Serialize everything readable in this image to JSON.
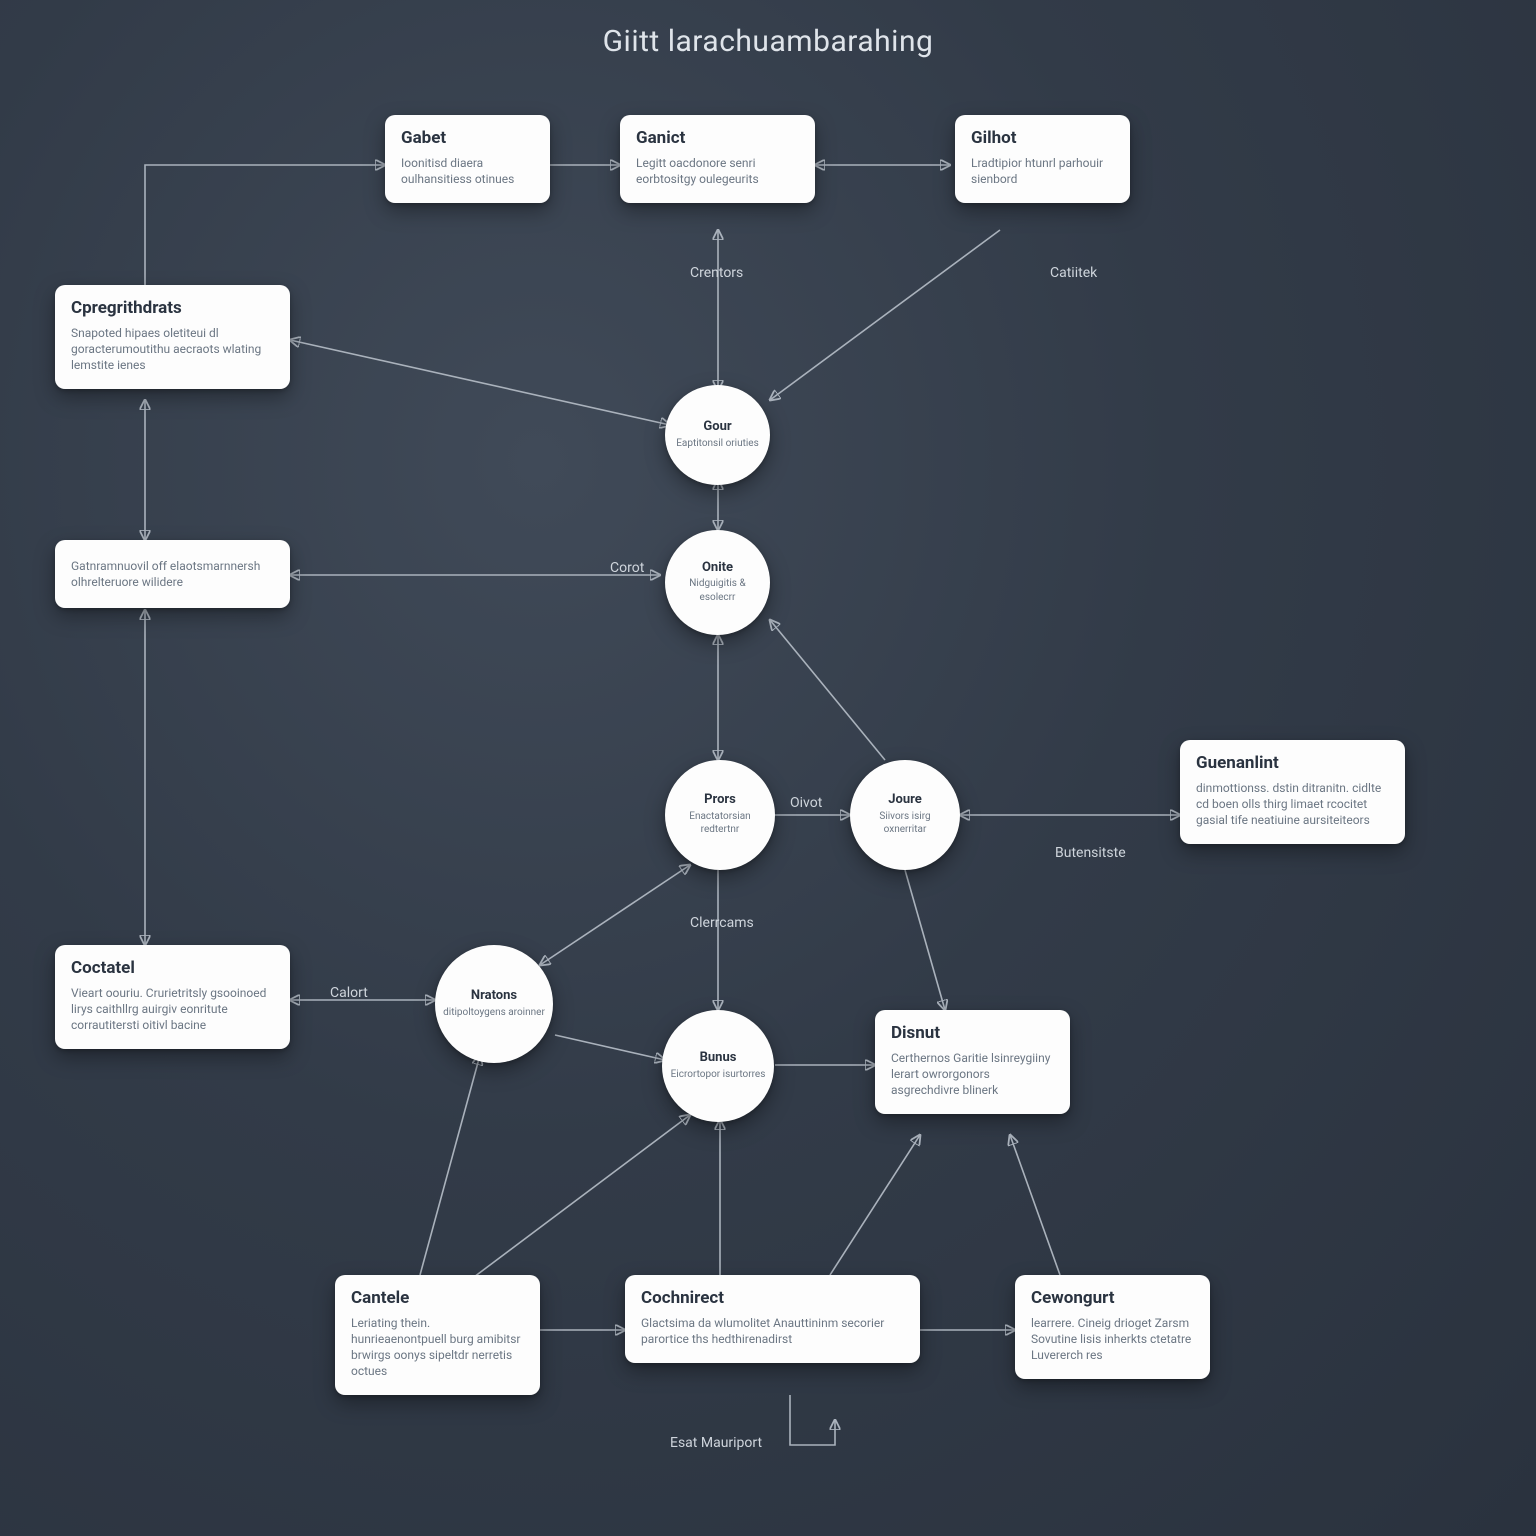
{
  "title": "Giitt larachuambarahing",
  "nodes": {
    "gabet": {
      "title": "Gabet",
      "body": "Ioonitisd diaera oulhansitiess otinues"
    },
    "ganict": {
      "title": "Ganict",
      "body": "Legitt oacdonore senri eorbtositgy oulegeurits"
    },
    "gilhot": {
      "title": "Gilhot",
      "body": "Lradtipior htunrl parhouir sienbord"
    },
    "cpregithdrats": {
      "title": "Cpregrithdrats",
      "body": "Snapoted hipaes oletiteui dl goracterumoutithu aecraots wlating lemstite ienes"
    },
    "gcompound": {
      "title": "",
      "body": "Gatnramnuovil off elaotsmarnnersh olhrelteruore wilidere"
    },
    "coctatel": {
      "title": "Coctatel",
      "body": "Vieart oouriu. Crurietritsly gsooinoed lirys caithllrg auirgiv eonritute corrautitersti oitivl bacine"
    },
    "guenanlint": {
      "title": "Guenanlint",
      "body": "dinmottionss. dstin ditranitn. cidlte cd boen olls thirg limaet rcocitet gasial tife neatiuine aursiteiteors"
    },
    "disnut": {
      "title": "Disnut",
      "body": "Certhernos Garitie lsinreygiiny lerart owrorgonors asgrechdivre blinerk"
    },
    "cantele": {
      "title": "Cantele",
      "body": "Leriating thein. hunrieaenontpuell burg amibitsr brwirgs oonys sipeltdr nerretis octues"
    },
    "cochinnct": {
      "title": "Cochnirect",
      "body": "Glactsima da wlumolitet Anauttininm secorier parortice ths hedthirenadirst"
    },
    "cevorgut": {
      "title": "Cewongurt",
      "body": "learrere. Cineig drioget Zarsm Sovutine lisis inherkts ctetatre Luvererch res"
    },
    "gour": {
      "title": "Gour",
      "body": "Eaptitonsil oriuties"
    },
    "onite": {
      "title": "Onite",
      "body": "Nidguigitis & esolecrr"
    },
    "prors": {
      "title": "Prors",
      "body": "Enactatorsian redtertnr"
    },
    "joure": {
      "title": "Joure",
      "body": "Siivors isirg oxnerritar"
    },
    "nratons": {
      "title": "Nratons",
      "body": "ditipoltoygens aroinner"
    },
    "bunus": {
      "title": "Bunus",
      "body": "Eicrortopor isurtorres"
    }
  },
  "edge_labels": {
    "crentors": "Crentors",
    "catiitek": "Catiitek",
    "corot": "Corot",
    "oivot": "Oivot",
    "clerrcams": "Clerrcams",
    "calort": "Calort",
    "butensitste": "Butensitste",
    "esat_mauriport": "Esat Mauriport"
  }
}
